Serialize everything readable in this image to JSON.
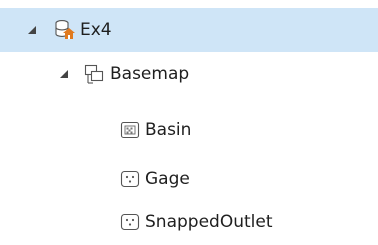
{
  "tree": {
    "root": {
      "label": "Ex4",
      "icon": "geodatabase-home-icon",
      "expanded": true,
      "selected": true
    },
    "group": {
      "label": "Basemap",
      "icon": "feature-dataset-icon",
      "expanded": true
    },
    "items": [
      {
        "label": "Basin",
        "icon": "raster-layer-icon"
      },
      {
        "label": "Gage",
        "icon": "point-feature-class-icon"
      },
      {
        "label": "SnappedOutlet",
        "icon": "point-feature-class-icon"
      }
    ]
  },
  "colors": {
    "selection": "#cfe5f7",
    "text": "#1f1f1f",
    "icon_stroke": "#555555",
    "home_accent": "#e07a1f"
  }
}
